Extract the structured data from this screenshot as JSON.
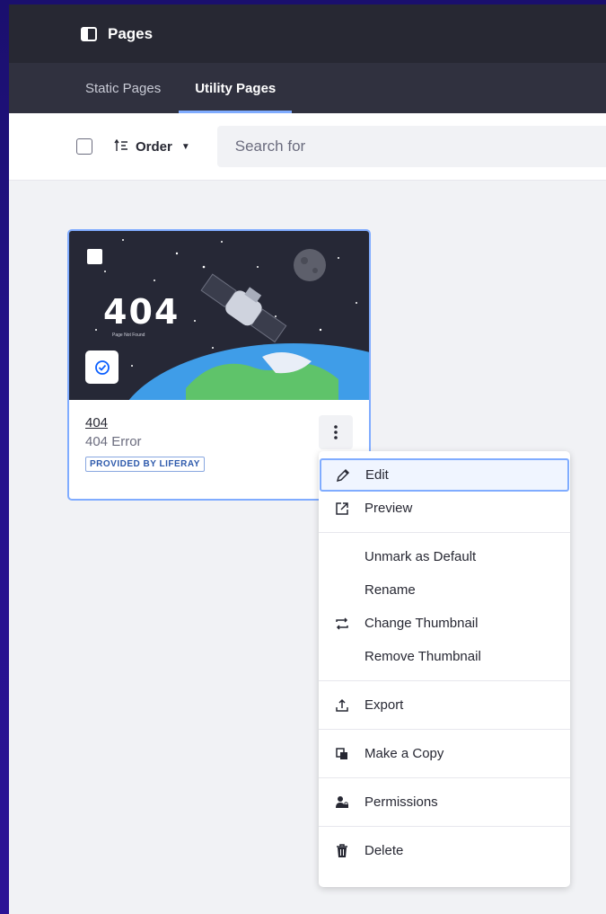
{
  "header": {
    "title": "Pages"
  },
  "tabs": [
    {
      "label": "Static Pages"
    },
    {
      "label": "Utility Pages"
    }
  ],
  "toolbar": {
    "order_label": "Order",
    "search_placeholder": "Search for"
  },
  "card": {
    "thumbnail_title": "404",
    "thumbnail_subtitle": "Page Not Found",
    "title": "404",
    "subtitle": "404 Error",
    "badge": "PROVIDED BY LIFERAY"
  },
  "menu": {
    "edit": "Edit",
    "preview": "Preview",
    "unmark_default": "Unmark as Default",
    "rename": "Rename",
    "change_thumbnail": "Change Thumbnail",
    "remove_thumbnail": "Remove Thumbnail",
    "export": "Export",
    "make_copy": "Make a Copy",
    "permissions": "Permissions",
    "delete": "Delete"
  },
  "colors": {
    "accent": "#80acff",
    "topbar": "#272833",
    "tabbar": "#30313f",
    "backdrop": "#24128a"
  }
}
